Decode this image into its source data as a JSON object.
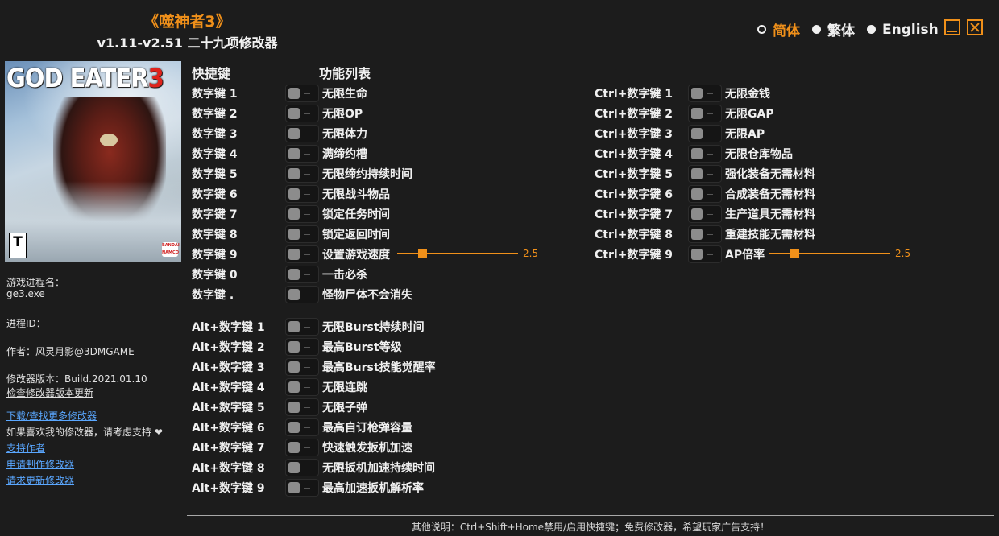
{
  "header": {
    "title": "《噬神者3》",
    "subtitle": "v1.11-v2.51 二十九项修改器"
  },
  "languages": [
    {
      "label": "简体",
      "active": true
    },
    {
      "label": "繁体",
      "active": false
    },
    {
      "label": "English",
      "active": false
    }
  ],
  "cover": {
    "logo_text": "GOD EATER",
    "logo_number": "3",
    "rating": "T",
    "publisher": "BANDAI NAMCO"
  },
  "sidebar": {
    "process_label": "游戏进程名：",
    "process_value": "ge3.exe",
    "pid_label": "进程ID：",
    "author": "作者：风灵月影@3DMGAME",
    "version": "修改器版本：Build.2021.01.10",
    "check_update": "检查修改器版本更新",
    "download_more": "下载/查找更多修改器",
    "support_text": "如果喜欢我的修改器，请考虑支持 ❤",
    "support_author": "支持作者",
    "request_trainer": "申请制作修改器",
    "request_update": "请求更新修改器"
  },
  "columns": {
    "hotkey": "快捷键",
    "features": "功能列表"
  },
  "left_items": [
    {
      "key": "数字键 1",
      "label": "无限生命"
    },
    {
      "key": "数字键 2",
      "label": "无限OP"
    },
    {
      "key": "数字键 3",
      "label": "无限体力"
    },
    {
      "key": "数字键 4",
      "label": "满缔约槽"
    },
    {
      "key": "数字键 5",
      "label": "无限缔约持续时间"
    },
    {
      "key": "数字键 6",
      "label": "无限战斗物品"
    },
    {
      "key": "数字键 7",
      "label": "锁定任务时间"
    },
    {
      "key": "数字键 8",
      "label": "锁定返回时间"
    },
    {
      "key": "数字键 9",
      "label": "设置游戏速度",
      "slider_value": "2.5"
    },
    {
      "key": "数字键 0",
      "label": "一击必杀"
    },
    {
      "key": "数字键 .",
      "label": "怪物尸体不会消失"
    }
  ],
  "alt_items": [
    {
      "key": "Alt+数字键 1",
      "label": "无限Burst持续时间"
    },
    {
      "key": "Alt+数字键 2",
      "label": "最高Burst等级"
    },
    {
      "key": "Alt+数字键 3",
      "label": "最高Burst技能觉醒率"
    },
    {
      "key": "Alt+数字键 4",
      "label": "无限连跳"
    },
    {
      "key": "Alt+数字键 5",
      "label": "无限子弹"
    },
    {
      "key": "Alt+数字键 6",
      "label": "最高自订枪弹容量"
    },
    {
      "key": "Alt+数字键 7",
      "label": "快速触发扳机加速"
    },
    {
      "key": "Alt+数字键 8",
      "label": "无限扳机加速持续时间"
    },
    {
      "key": "Alt+数字键 9",
      "label": "最高加速扳机解析率"
    }
  ],
  "ctrl_items": [
    {
      "key": "Ctrl+数字键 1",
      "label": "无限金钱"
    },
    {
      "key": "Ctrl+数字键 2",
      "label": "无限GAP"
    },
    {
      "key": "Ctrl+数字键 3",
      "label": "无限AP"
    },
    {
      "key": "Ctrl+数字键 4",
      "label": "无限仓库物品"
    },
    {
      "key": "Ctrl+数字键 5",
      "label": "强化装备无需材料"
    },
    {
      "key": "Ctrl+数字键 6",
      "label": "合成装备无需材料"
    },
    {
      "key": "Ctrl+数字键 7",
      "label": "生产道具无需材料"
    },
    {
      "key": "Ctrl+数字键 8",
      "label": "重建技能无需材料"
    },
    {
      "key": "Ctrl+数字键 9",
      "label": "AP倍率",
      "slider_value": "2.5"
    }
  ],
  "footer": "其他说明：Ctrl+Shift+Home禁用/启用快捷键；免费修改器，希望玩家广告支持！",
  "slider_fraction": 0.19,
  "accent_color": "#f0901a"
}
